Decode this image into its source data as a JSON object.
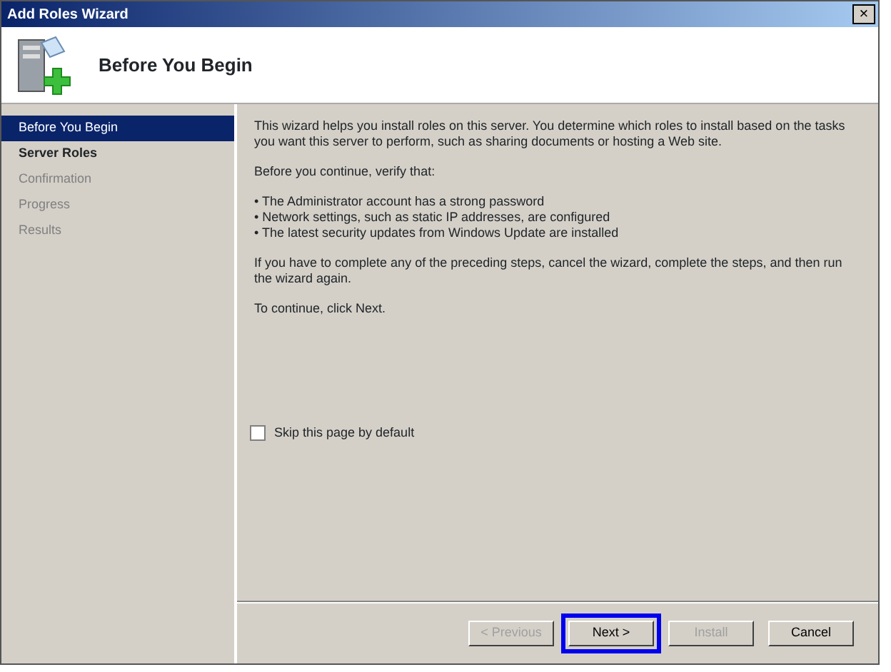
{
  "window": {
    "title": "Add Roles Wizard",
    "close": "×"
  },
  "header": {
    "title": "Before You Begin"
  },
  "steps": [
    {
      "label": "Before You Begin",
      "selected": true,
      "disabled": false
    },
    {
      "label": "Server Roles",
      "selected": false,
      "disabled": false
    },
    {
      "label": "Confirmation",
      "selected": false,
      "disabled": true
    },
    {
      "label": "Progress",
      "selected": false,
      "disabled": true
    },
    {
      "label": "Results",
      "selected": false,
      "disabled": true
    }
  ],
  "content": {
    "paragraphs": [
      "This wizard helps you install roles on this server. You determine which roles to install based on the tasks you want this server to perform, such as sharing documents or hosting a Web site.",
      "Before you continue, verify that:"
    ],
    "bullets": [
      "The Administrator account has a strong password",
      "Network settings, such as static IP addresses, are configured",
      "The latest security updates from Windows Update are installed"
    ],
    "after": [
      "If you have to complete any of the preceding steps, cancel the wizard, complete the steps, and then run the wizard again.",
      "To continue, click Next."
    ],
    "bullet_char": "•"
  },
  "skip_checkbox": {
    "label": "Skip this page by default",
    "checked": false
  },
  "buttons": [
    {
      "label": "< Previous",
      "disabled": true,
      "highlighted": false
    },
    {
      "label": "Next >",
      "disabled": false,
      "highlighted": true
    },
    {
      "label": "Install",
      "disabled": true,
      "highlighted": false
    },
    {
      "label": "Cancel",
      "disabled": false,
      "highlighted": false
    }
  ]
}
